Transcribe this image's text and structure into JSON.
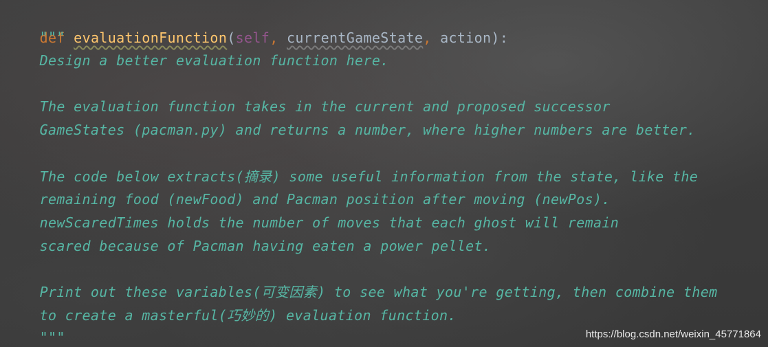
{
  "code": {
    "def_line": {
      "keyword": "def",
      "function_name": "evaluationFunction",
      "open_paren": "(",
      "self_param": "self",
      "sep1": ", ",
      "param1": "currentGameState",
      "sep2": ", ",
      "param2": "action",
      "close": "):"
    },
    "docstring_lines": [
      "    \"\"\"",
      "    Design a better evaluation function here.",
      "",
      "    The evaluation function takes in the current and proposed successor",
      "    GameStates (pacman.py) and returns a number, where higher numbers are better.",
      "",
      "    The code below extracts(摘录) some useful information from the state, like the",
      "    remaining food (newFood) and Pacman position after moving (newPos).",
      "    newScaredTimes holds the number of moves that each ghost will remain",
      "    scared because of Pacman having eaten a power pellet.",
      "",
      "    Print out these variables(可变因素) to see what you're getting, then combine them",
      "    to create a masterful(巧妙的) evaluation function.",
      "    \"\"\""
    ]
  },
  "watermark": "https://blog.csdn.net/weixin_45771864",
  "colors": {
    "keyword": "#cc7832",
    "function_name": "#ffc66d",
    "self": "#94558d",
    "docstring": "#56b6a4",
    "plain": "#a9b7c6"
  }
}
